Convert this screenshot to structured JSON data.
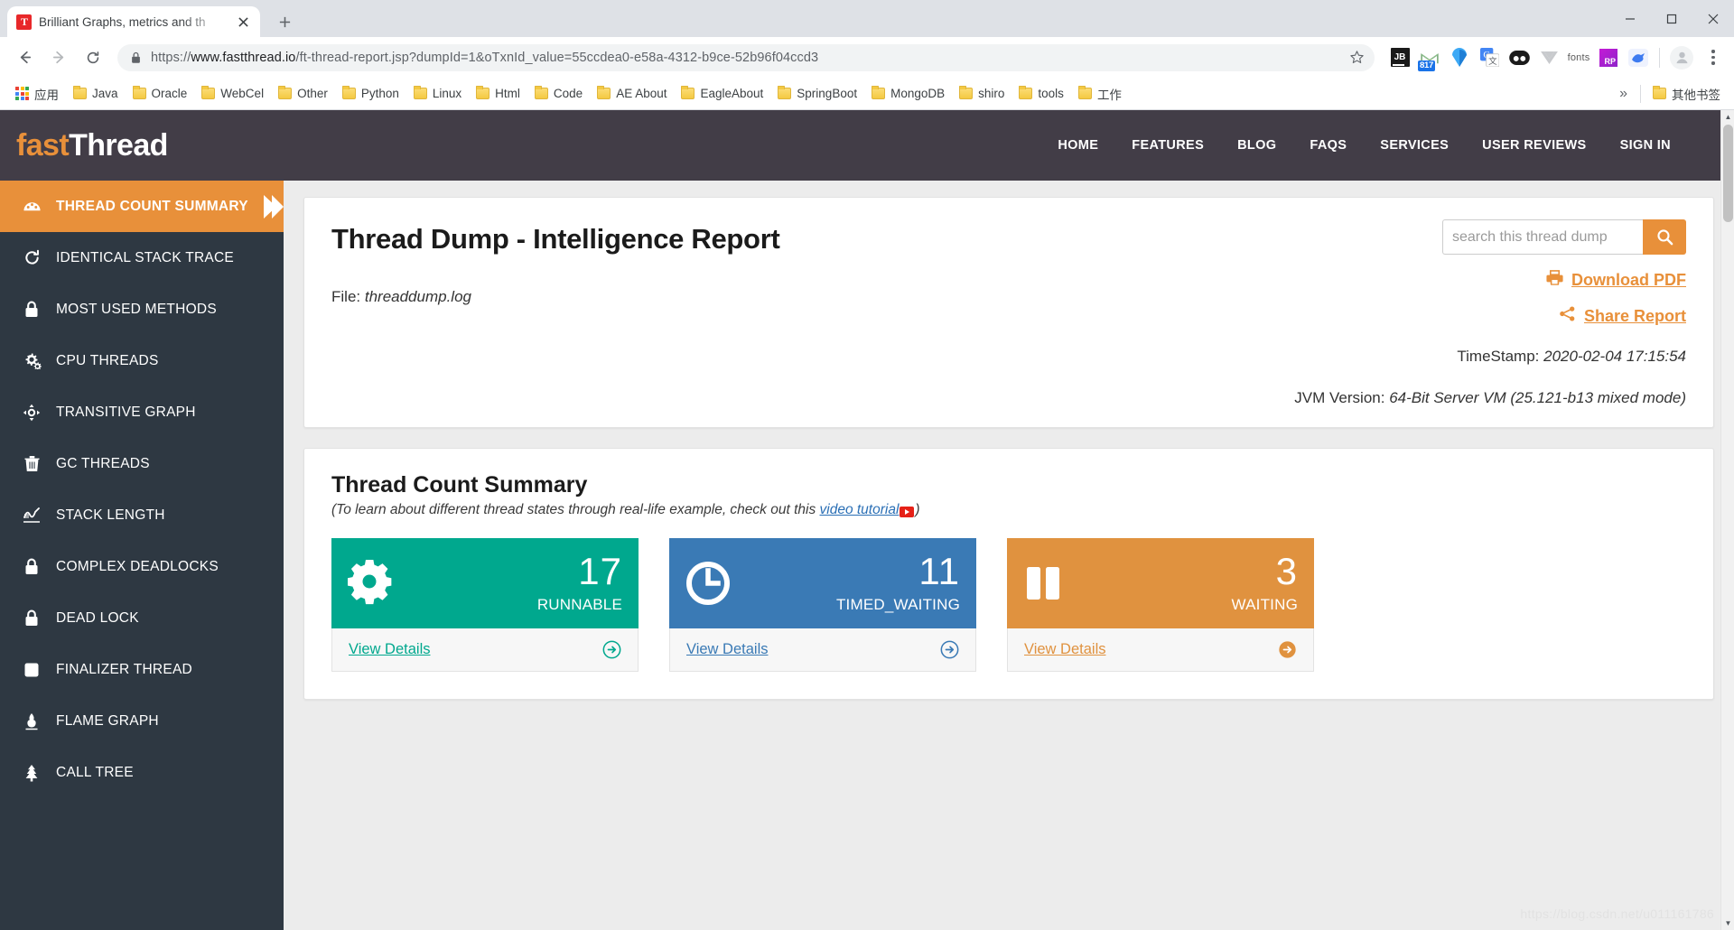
{
  "browser": {
    "tab": {
      "title": "Brilliant Graphs, metrics and th",
      "favicon_text": "T",
      "close_icon": "close-icon"
    },
    "new_tab_label": "+",
    "window_controls": [
      "minimize",
      "maximize",
      "close"
    ],
    "nav": {
      "back": "back-arrow",
      "forward": "forward-arrow",
      "reload": "reload-icon"
    },
    "url": {
      "scheme": "https://",
      "host": "www.fastthread.io",
      "path": "/ft-thread-report.jsp?dumpId=1&oTxnId_value=55ccdea0-e58a-4312-b9ce-52b96f04ccd3",
      "full": "https://www.fastthread.io/ft-thread-report.jsp?dumpId=1&oTxnId_value=55ccdea0-e58a-4312-b9ce-52b96f04ccd3"
    },
    "extensions": [
      {
        "name": "jetbrains-toolbox-icon",
        "label": "JB"
      },
      {
        "name": "mail-icon",
        "badge": "817"
      },
      {
        "name": "diamond-icon"
      },
      {
        "name": "google-translate-icon",
        "label": "G"
      },
      {
        "name": "momentum-icon"
      },
      {
        "name": "vue-devtools-icon"
      },
      {
        "name": "fonts-icon",
        "label": "fonts"
      },
      {
        "name": "readability-icon",
        "label": "RP"
      },
      {
        "name": "kiwi-bird-icon"
      }
    ],
    "bookmarks": [
      {
        "name": "apps",
        "label": "应用",
        "icon": "apps-grid-icon"
      },
      {
        "name": "java",
        "label": "Java",
        "icon": "folder-icon"
      },
      {
        "name": "oracle",
        "label": "Oracle",
        "icon": "folder-icon"
      },
      {
        "name": "webcel",
        "label": "WebCel",
        "icon": "folder-icon"
      },
      {
        "name": "other",
        "label": "Other",
        "icon": "folder-icon"
      },
      {
        "name": "python",
        "label": "Python",
        "icon": "folder-icon"
      },
      {
        "name": "linux",
        "label": "Linux",
        "icon": "folder-icon"
      },
      {
        "name": "html",
        "label": "Html",
        "icon": "folder-icon"
      },
      {
        "name": "code",
        "label": "Code",
        "icon": "folder-icon"
      },
      {
        "name": "ae-about",
        "label": "AE About",
        "icon": "folder-icon"
      },
      {
        "name": "eagleabout",
        "label": "EagleAbout",
        "icon": "folder-icon"
      },
      {
        "name": "springboot",
        "label": "SpringBoot",
        "icon": "folder-icon"
      },
      {
        "name": "mongodb",
        "label": "MongoDB",
        "icon": "folder-icon"
      },
      {
        "name": "shiro",
        "label": "shiro",
        "icon": "folder-icon"
      },
      {
        "name": "tools",
        "label": "tools",
        "icon": "folder-icon"
      },
      {
        "name": "work",
        "label": "工作",
        "icon": "folder-icon"
      }
    ],
    "bookmarks_overflow": "»",
    "other_bookmarks": {
      "label": "其他书签",
      "icon": "folder-icon"
    }
  },
  "site": {
    "logo": {
      "first": "fast",
      "second": "Thread"
    },
    "nav": [
      {
        "name": "home",
        "label": "HOME"
      },
      {
        "name": "features",
        "label": "FEATURES"
      },
      {
        "name": "blog",
        "label": "BLOG"
      },
      {
        "name": "faqs",
        "label": "FAQS"
      },
      {
        "name": "services",
        "label": "SERVICES"
      },
      {
        "name": "user-reviews",
        "label": "USER REVIEWS"
      },
      {
        "name": "sign-in",
        "label": "SIGN IN"
      }
    ]
  },
  "sidebar": {
    "items": [
      {
        "name": "thread-count-summary",
        "label": "THREAD COUNT SUMMARY",
        "icon": "dashboard-gauge-icon",
        "active": true
      },
      {
        "name": "identical-stack-trace",
        "label": "IDENTICAL STACK TRACE",
        "icon": "refresh-icon",
        "active": false
      },
      {
        "name": "most-used-methods",
        "label": "MOST USED METHODS",
        "icon": "lock-icon",
        "active": false
      },
      {
        "name": "cpu-threads",
        "label": "CPU THREADS",
        "icon": "gears-icon",
        "active": false
      },
      {
        "name": "transitive-graph",
        "label": "TRANSITIVE GRAPH",
        "icon": "arrows-alt-icon",
        "active": false
      },
      {
        "name": "gc-threads",
        "label": "GC THREADS",
        "icon": "trash-icon",
        "active": false
      },
      {
        "name": "stack-length",
        "label": "STACK LENGTH",
        "icon": "signature-icon",
        "active": false
      },
      {
        "name": "complex-deadlocks",
        "label": "COMPLEX DEADLOCKS",
        "icon": "lock-icon",
        "active": false
      },
      {
        "name": "dead-lock",
        "label": "DEAD LOCK",
        "icon": "lock-icon",
        "active": false
      },
      {
        "name": "finalizer-thread",
        "label": "FINALIZER THREAD",
        "icon": "square-icon",
        "active": false
      },
      {
        "name": "flame-graph",
        "label": "FLAME GRAPH",
        "icon": "flame-icon",
        "active": false
      },
      {
        "name": "call-tree",
        "label": "CALL TREE",
        "icon": "tree-icon",
        "active": false
      }
    ]
  },
  "report": {
    "title": "Thread Dump - Intelligence Report",
    "file_label": "File:",
    "file_value": "threaddump.log",
    "search": {
      "placeholder": "search this thread dump",
      "value": "",
      "button_icon": "search-icon"
    },
    "download_pdf": {
      "label": "Download PDF",
      "icon": "printer-icon"
    },
    "share_report": {
      "label": "Share Report",
      "icon": "share-icon"
    },
    "timestamp_label": "TimeStamp:",
    "timestamp_value": "2020-02-04 17:15:54",
    "jvm_label": "JVM Version:",
    "jvm_value": "64-Bit Server VM (25.121-b13 mixed mode)"
  },
  "summary": {
    "title": "Thread Count Summary",
    "subtitle_before": "(To learn about different thread states through real-life example, check out this ",
    "subtitle_link": "video tutorial",
    "subtitle_after": ")",
    "view_details_label": "View Details",
    "cards": [
      {
        "name": "runnable-card",
        "count": "17",
        "state": "RUNNABLE",
        "color": "#00a88e",
        "icon": "gear-icon"
      },
      {
        "name": "timed-waiting-card",
        "count": "11",
        "state": "TIMED_WAITING",
        "color": "#3a7ab5",
        "icon": "clock-icon"
      },
      {
        "name": "waiting-card",
        "count": "3",
        "state": "WAITING",
        "color": "#e0923f",
        "icon": "pause-icon"
      }
    ]
  },
  "watermark": "https://blog.csdn.net/u011161786",
  "colors": {
    "brand_orange": "#e8903a",
    "header_dark": "#423d47",
    "sidebar_dark": "#2e3842",
    "runnable_teal": "#00a88e",
    "timed_waiting_blue": "#3a7ab5",
    "waiting_orange": "#e0923f",
    "page_bg": "#ececec"
  }
}
